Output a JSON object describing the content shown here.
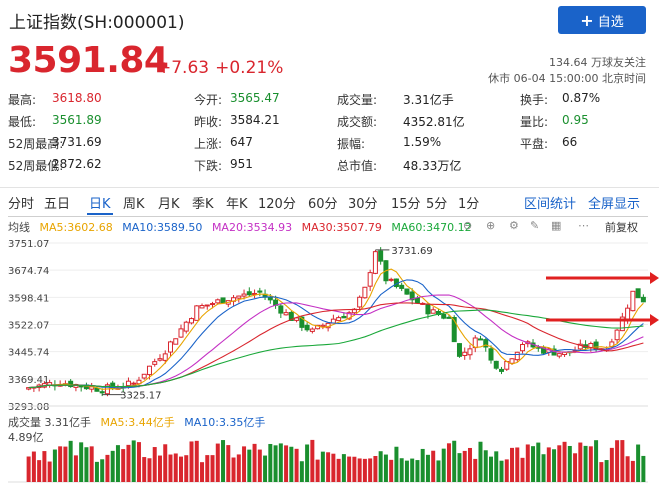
{
  "header": {
    "title": "上证指数(SH:000001)",
    "add_button": "自选",
    "price": "3591.84",
    "change": "+7.63",
    "change_pct": "+0.21%",
    "followers": "134.64 万球友关注",
    "status": "休市 06-04 15:00:00 北京时间"
  },
  "stats": [
    {
      "label": "最高:",
      "value": "3618.80",
      "color": "red"
    },
    {
      "label": "今开:",
      "value": "3565.47",
      "color": "green"
    },
    {
      "label": "成交量:",
      "value": "3.31亿手",
      "color": "blk"
    },
    {
      "label": "换手:",
      "value": "0.87%",
      "color": "blk"
    },
    {
      "label": "最低:",
      "value": "3561.89",
      "color": "green"
    },
    {
      "label": "昨收:",
      "value": "3584.21",
      "color": "blk"
    },
    {
      "label": "成交额:",
      "value": "4352.81亿",
      "color": "blk"
    },
    {
      "label": "量比:",
      "value": "0.95",
      "color": "green"
    },
    {
      "label": "52周最高:",
      "value": "3731.69",
      "color": "blk"
    },
    {
      "label": "上涨:",
      "value": "647",
      "color": "blk"
    },
    {
      "label": "振幅:",
      "value": "1.59%",
      "color": "blk"
    },
    {
      "label": "平盘:",
      "value": "66",
      "color": "blk"
    },
    {
      "label": "52周最低:",
      "value": "2872.62",
      "color": "blk"
    },
    {
      "label": "下跌:",
      "value": "951",
      "color": "blk"
    },
    {
      "label": "总市值:",
      "value": "48.33万亿",
      "color": "blk"
    }
  ],
  "tabs": [
    "分时",
    "五日",
    "日K",
    "周K",
    "月K",
    "季K",
    "年K",
    "120分",
    "60分",
    "30分",
    "15分",
    "5分",
    "1分"
  ],
  "active_tab": "日K",
  "links": {
    "interval": "区间统计",
    "fullscreen": "全屏显示"
  },
  "tools": {
    "adjust": "前复权"
  },
  "ma_legend": {
    "avg": "均线",
    "ma5": "MA5:3602.68",
    "ma10": "MA10:3589.50",
    "ma20": "MA20:3534.93",
    "ma30": "MA30:3507.79",
    "ma60": "MA60:3470.12"
  },
  "vol_legend": {
    "vol": "成交量 3.31亿手",
    "ma5": "MA5:3.44亿手",
    "ma10": "MA10:3.35亿手",
    "max": "4.89亿"
  },
  "colors": {
    "up": "#d9262e",
    "down": "#1a8f2e",
    "ma5": "#e8a400",
    "ma10": "#1a63c9",
    "ma20": "#c430c4",
    "ma30": "#d9262e",
    "ma60": "#1aa83a",
    "accent": "#1a63c9"
  },
  "chart_data": {
    "type": "candlestick",
    "y_ticks": [
      "3751.07",
      "3674.74",
      "3598.41",
      "3522.07",
      "3445.74",
      "3369.41",
      "3293.08"
    ],
    "ylim": [
      3293.08,
      3751.07
    ],
    "annotations": [
      {
        "text": "3731.69",
        "value": 3731.69
      },
      {
        "text": "3325.17",
        "value": 3325.17
      }
    ],
    "high_52w": 3731.69,
    "low_visible": 3325.17,
    "last_close": 3591.84,
    "ma_current": {
      "MA5": 3602.68,
      "MA10": 3589.5,
      "MA20": 3534.93,
      "MA30": 3507.79,
      "MA60": 3470.12
    },
    "volume_max": 4.89,
    "volume_current": 3.31,
    "volume_ma": {
      "MA5": 3.44,
      "MA10": 3.35
    }
  }
}
